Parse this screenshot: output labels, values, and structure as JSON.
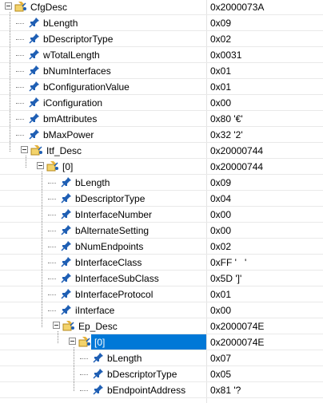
{
  "tree": {
    "rows": [
      {
        "name": "CfgDesc",
        "value": "0x2000073A"
      },
      {
        "name": "bLength",
        "value": "0x09"
      },
      {
        "name": "bDescriptorType",
        "value": "0x02"
      },
      {
        "name": "wTotalLength",
        "value": "0x0031"
      },
      {
        "name": "bNumInterfaces",
        "value": "0x01"
      },
      {
        "name": "bConfigurationValue",
        "value": "0x01"
      },
      {
        "name": "iConfiguration",
        "value": "0x00"
      },
      {
        "name": "bmAttributes",
        "value": "0x80 '€'"
      },
      {
        "name": "bMaxPower",
        "value": "0x32 '2'"
      },
      {
        "name": "Itf_Desc",
        "value": "0x20000744"
      },
      {
        "name": "[0]",
        "value": "0x20000744"
      },
      {
        "name": "bLength",
        "value": "0x09"
      },
      {
        "name": "bDescriptorType",
        "value": "0x04"
      },
      {
        "name": "bInterfaceNumber",
        "value": "0x00"
      },
      {
        "name": "bAlternateSetting",
        "value": "0x00"
      },
      {
        "name": "bNumEndpoints",
        "value": "0x02"
      },
      {
        "name": "bInterfaceClass",
        "value": "0xFF '   '"
      },
      {
        "name": "bInterfaceSubClass",
        "value": "0x5D ']'"
      },
      {
        "name": "bInterfaceProtocol",
        "value": "0x01"
      },
      {
        "name": "iInterface",
        "value": "0x00"
      },
      {
        "name": "Ep_Desc",
        "value": "0x2000074E"
      },
      {
        "name": "[0]",
        "value": "0x2000074E"
      },
      {
        "name": "bLength",
        "value": "0x07"
      },
      {
        "name": "bDescriptorType",
        "value": "0x05"
      },
      {
        "name": "bEndpointAddress",
        "value": "0x81 '?"
      }
    ]
  },
  "colors": {
    "selection": "#0078d7",
    "pin": "#1f5fb4",
    "folder": "#e8c25a"
  },
  "icons": {
    "field": "pin-icon",
    "struct": "struct-folder-icon",
    "toggle": "collapse-icon"
  }
}
